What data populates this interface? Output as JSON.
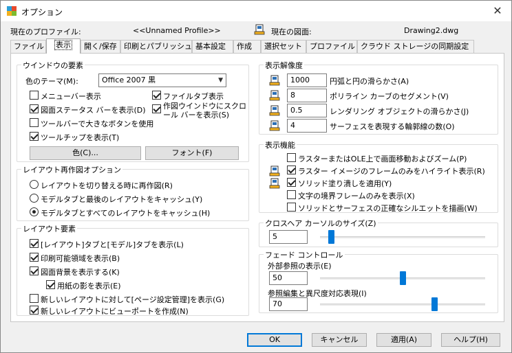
{
  "window": {
    "title": "オプション",
    "close": "✕"
  },
  "profile": {
    "current_profile_label": "現在のプロファイル:",
    "current_profile_value": "<<Unnamed Profile>>",
    "current_drawing_label": "現在の図面:",
    "current_drawing_value": "Drawing2.dwg"
  },
  "tabs": [
    {
      "label": "ファイル"
    },
    {
      "label": "表示"
    },
    {
      "label": "開く/保存"
    },
    {
      "label": "印刷とパブリッシュ"
    },
    {
      "label": "基本設定"
    },
    {
      "label": "作成"
    },
    {
      "label": "選択セット"
    },
    {
      "label": "プロファイル"
    },
    {
      "label": "クラウド ストレージの同期設定"
    }
  ],
  "window_elements": {
    "title": "ウインドウの要素",
    "color_theme_label": "色のテーマ(M):",
    "color_theme_value": "Office 2007 黒",
    "checks": [
      {
        "label": "メニューバー表示",
        "checked": false
      },
      {
        "label": "ファイルタブ表示",
        "checked": true
      },
      {
        "label": "図面ステータス バーを表示(D)",
        "checked": true
      },
      {
        "label": "作図ウインドウにスクロール バーを表示(S)",
        "checked": true
      },
      {
        "label": "ツールバーで大きなボタンを使用",
        "checked": false
      },
      {
        "label": "ツールチップを表示(T)",
        "checked": true
      }
    ],
    "color_button": "色(C)...",
    "font_button": "フォント(F)"
  },
  "layout_regen": {
    "title": "レイアウト再作図オプション",
    "options": [
      {
        "label": "レイアウトを切り替える時に再作図(R)",
        "checked": false
      },
      {
        "label": "モデルタブと最後のレイアウトをキャッシュ(Y)",
        "checked": false
      },
      {
        "label": "モデルタブとすべてのレイアウトをキャッシュ(H)",
        "checked": true
      }
    ]
  },
  "layout_elements": {
    "title": "レイアウト要素",
    "checks": [
      {
        "label": "[レイアウト]タブと[モデル]タブを表示(L)",
        "checked": true
      },
      {
        "label": "印刷可能領域を表示(B)",
        "checked": true
      },
      {
        "label": "図面背景を表示する(K)",
        "checked": true
      },
      {
        "label": "用紙の影を表示(E)",
        "checked": true
      },
      {
        "label": "新しいレイアウトに対して[ページ設定管理]を表示(G)",
        "checked": false
      },
      {
        "label": "新しいレイアウトにビューポートを作成(N)",
        "checked": true
      }
    ]
  },
  "display_resolution": {
    "title": "表示解像度",
    "rows": [
      {
        "value": "1000",
        "label": "円弧と円の滑らかさ(A)"
      },
      {
        "value": "8",
        "label": "ポリライン カーブのセグメント(V)"
      },
      {
        "value": "0.5",
        "label": "レンダリング オブジェクトの滑らかさ(J)"
      },
      {
        "value": "4",
        "label": "サーフェスを表現する輪郭線の数(O)"
      }
    ]
  },
  "display_performance": {
    "title": "表示機能",
    "checks": [
      {
        "label": "ラスターまたはOLE上で画面移動およびズーム(P)",
        "checked": false
      },
      {
        "label": "ラスター イメージのフレームのみをハイライト表示(R)",
        "checked": true
      },
      {
        "label": "ソリッド塗り潰しを適用(Y)",
        "checked": true
      },
      {
        "label": "文字の境界フレームのみを表示(X)",
        "checked": false
      },
      {
        "label": "ソリッドとサーフェスの正確なシルエットを描画(W)",
        "checked": false
      }
    ]
  },
  "crosshair": {
    "title": "クロスヘア カーソルのサイズ(Z)",
    "value": "5",
    "level_percent": 5
  },
  "fade": {
    "title": "フェード コントロール",
    "xref_label": "外部参照の表示(E)",
    "xref_value": "50",
    "xref_level_percent": 50,
    "inplace_label": "参照編集と異尺度対応表現(I)",
    "inplace_value": "70",
    "inplace_level_percent": 70
  },
  "buttons": {
    "ok": "OK",
    "cancel": "キャンセル",
    "apply": "適用(A)",
    "help": "ヘルプ(H)"
  }
}
